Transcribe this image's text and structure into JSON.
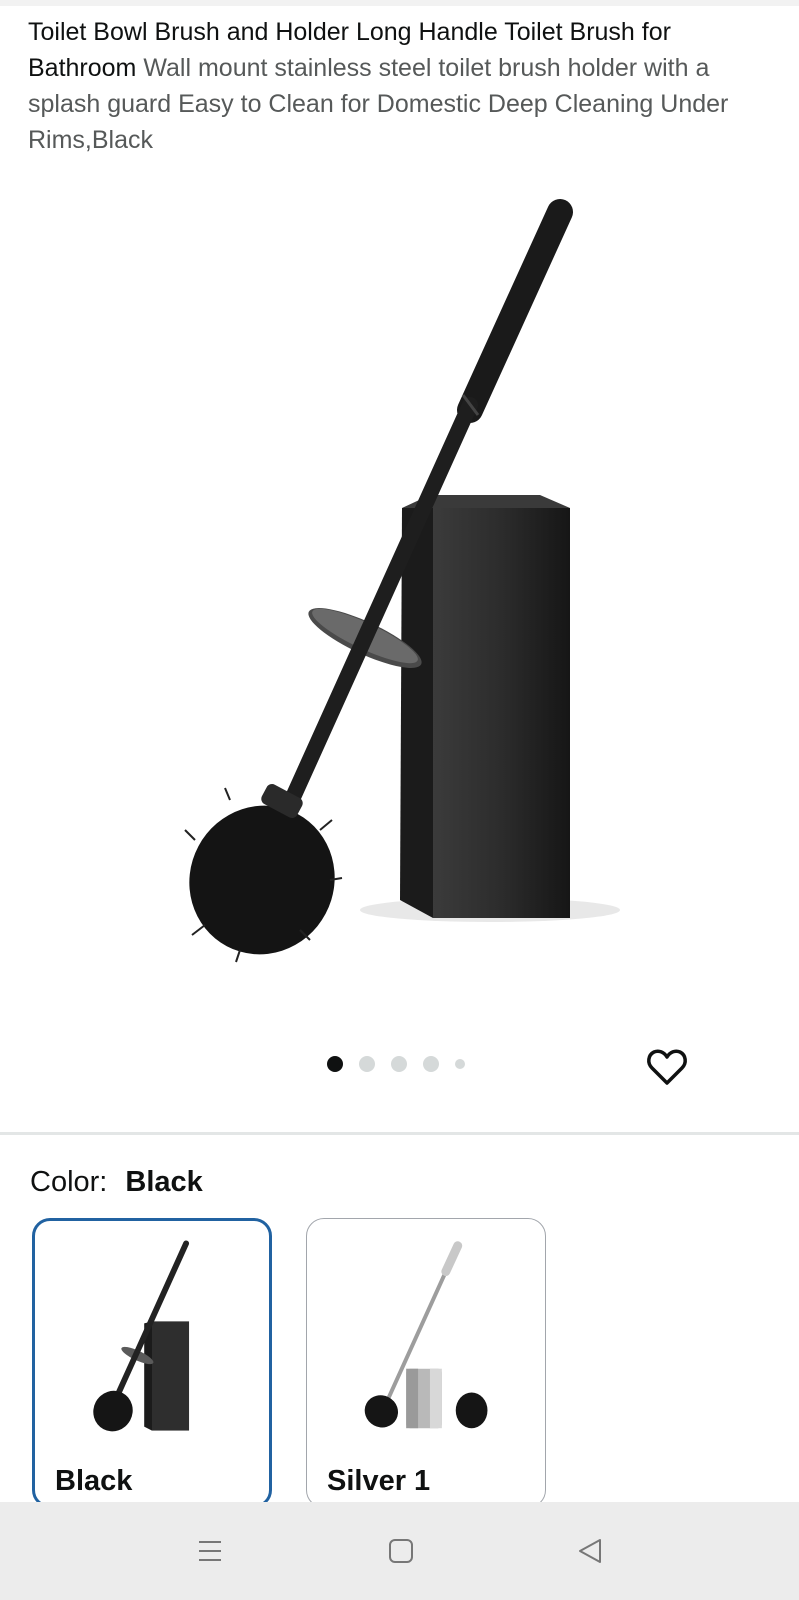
{
  "product": {
    "title": "Toilet Bowl Brush and Holder Long Handle Toilet Brush for Bathroom",
    "subtitle": "Wall mount stainless steel toilet brush holder with a splash guard Easy to Clean for Domestic Deep Cleaning Under Rims,Black"
  },
  "gallery": {
    "image_count": 5,
    "active_index": 0,
    "hero_image": "black-toilet-brush-and-holder",
    "favorite_icon": "heart-icon"
  },
  "variation": {
    "label": "Color:",
    "selected": "Black",
    "options": [
      {
        "name": "Black",
        "thumb": "black-brush-thumbnail",
        "selected": true
      },
      {
        "name": "Silver 1",
        "thumb": "silver-brush-thumbnail",
        "selected": false
      }
    ]
  },
  "navbar": {
    "items": [
      "menu-icon",
      "home-icon",
      "back-icon"
    ]
  },
  "colors": {
    "selected_border": "#2162a1",
    "text": "#0f1111",
    "secondary_text": "#565959",
    "navbar_bg": "#ececec"
  }
}
